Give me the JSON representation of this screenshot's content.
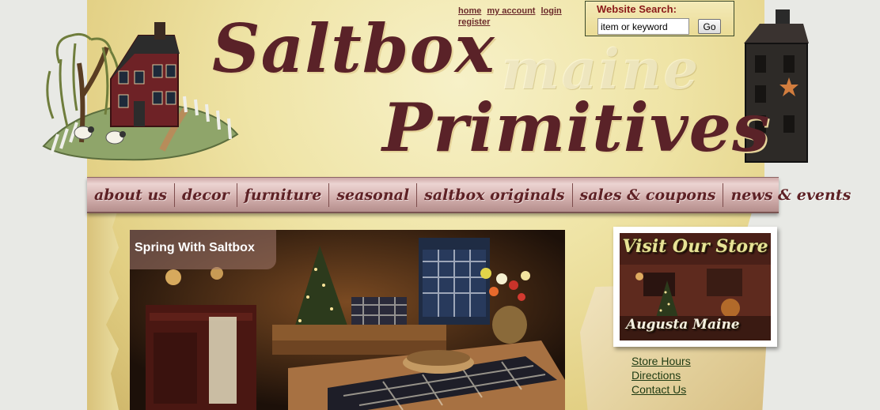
{
  "logo": {
    "line1": "Saltbox",
    "word_maine": "maine",
    "line2": "Primitives"
  },
  "top_links": {
    "home": "home",
    "my_account": "my account",
    "login": "login",
    "register": "register"
  },
  "search": {
    "title": "Website Search:",
    "value": "item or keyword",
    "button_label": "Go"
  },
  "nav": {
    "items": [
      {
        "label": "about us"
      },
      {
        "label": "decor"
      },
      {
        "label": "furniture"
      },
      {
        "label": "seasonal"
      },
      {
        "label": "saltbox originals"
      },
      {
        "label": "sales & coupons"
      },
      {
        "label": "news & events"
      }
    ]
  },
  "slideshow": {
    "title": "Spring With Saltbox"
  },
  "store": {
    "visit_label": "Visit Our Store",
    "city_label": "Augusta Maine",
    "links": [
      {
        "label": "Store Hours"
      },
      {
        "label": "Directions"
      },
      {
        "label": "Contact Us"
      }
    ]
  },
  "colors": {
    "brand_maroon": "#5a2228",
    "link_dark_red": "#6b2a2a",
    "search_title_red": "#8a1818",
    "store_link_green": "#1e3a12",
    "nav_pink": "#d6b3b1",
    "parchment": "#efe4a6"
  }
}
